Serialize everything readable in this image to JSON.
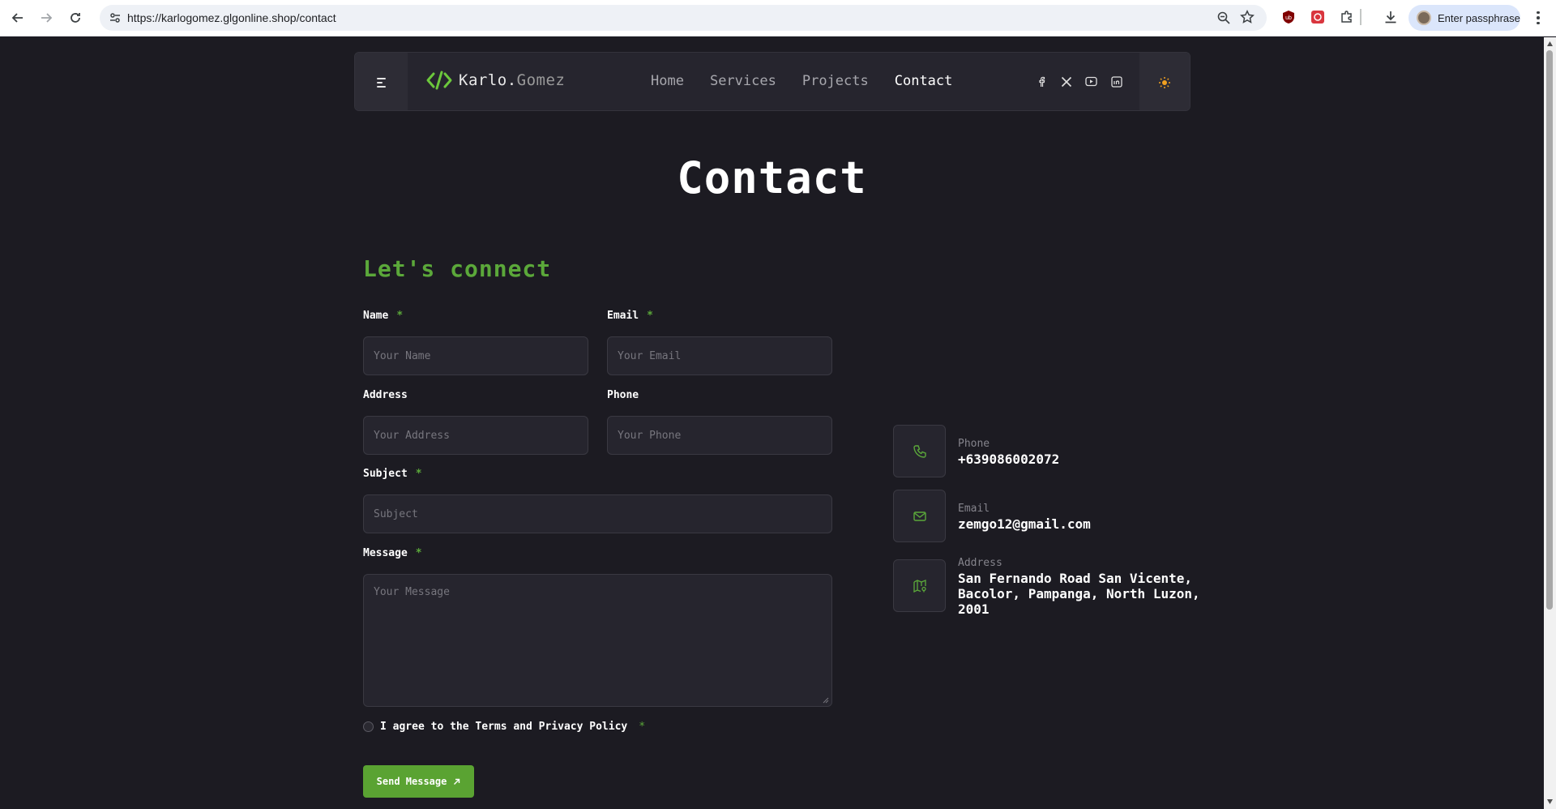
{
  "browser": {
    "url": "https://karlogomez.glgonline.shop/contact",
    "profile_label": "Enter passphrase"
  },
  "header": {
    "logo_main": "Karlo.",
    "logo_dim": "Gomez",
    "nav": [
      {
        "label": "Home",
        "active": false
      },
      {
        "label": "Services",
        "active": false
      },
      {
        "label": "Projects",
        "active": false
      },
      {
        "label": "Contact",
        "active": true
      }
    ],
    "socials": [
      "facebook-icon",
      "x-icon",
      "youtube-icon",
      "linkedin-icon"
    ],
    "theme_icon": "sun-icon"
  },
  "page": {
    "title": "Contact"
  },
  "form": {
    "heading": "Let's connect",
    "name": {
      "label": "Name",
      "required": "*",
      "placeholder": "Your Name"
    },
    "email": {
      "label": "Email",
      "required": "*",
      "placeholder": "Your Email"
    },
    "address": {
      "label": "Address",
      "placeholder": "Your Address"
    },
    "phone": {
      "label": "Phone",
      "placeholder": "Your Phone"
    },
    "subject": {
      "label": "Subject",
      "required": "*",
      "placeholder": "Subject"
    },
    "message": {
      "label": "Message",
      "required": "*",
      "placeholder": "Your Message"
    },
    "agree_text": "I agree to the Terms and Privacy Policy",
    "agree_required": "*",
    "submit_label": "Send Message"
  },
  "contact_info": {
    "phone": {
      "label": "Phone",
      "value": "+639086002072"
    },
    "email": {
      "label": "Email",
      "value": "zemgo12@gmail.com"
    },
    "address": {
      "label": "Address",
      "value": "San Fernando Road San Vicente, Bacolor, Pampanga, North Luzon, 2001"
    }
  },
  "colors": {
    "accent": "#5ba83a",
    "background": "#1c1b22",
    "panel": "#26252e"
  }
}
